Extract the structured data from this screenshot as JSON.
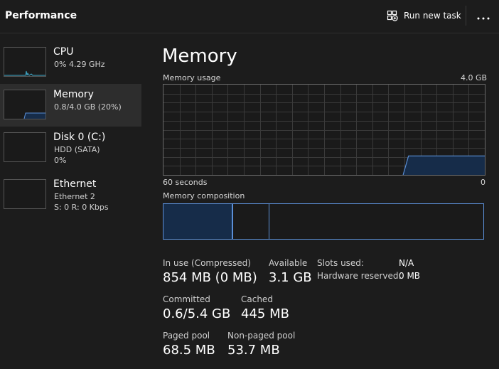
{
  "header": {
    "title": "Performance",
    "run_task_label": "Run new task",
    "more_label": "···"
  },
  "sidebar": {
    "items": [
      {
        "name": "CPU",
        "sub1": "0% 4.29 GHz",
        "sub2": ""
      },
      {
        "name": "Memory",
        "sub1": "0.8/4.0 GB (20%)",
        "sub2": ""
      },
      {
        "name": "Disk 0 (C:)",
        "sub1": "HDD (SATA)",
        "sub2": "0%"
      },
      {
        "name": "Ethernet",
        "sub1": "Ethernet 2",
        "sub2": "S: 0 R: 0 Kbps"
      }
    ],
    "selected_index": 1
  },
  "main": {
    "title": "Memory",
    "usage_label": "Memory usage",
    "usage_max": "4.0 GB",
    "time_span_label": "60 seconds",
    "time_end_label": "0",
    "composition_label": "Memory composition",
    "composition": {
      "in_use_fraction": 0.213,
      "modified_fraction": 0.004,
      "standby_fraction": 0.111
    },
    "usage_history": {
      "samples_fraction": [
        0,
        0,
        0,
        0,
        0,
        0,
        0,
        0,
        0,
        0,
        0,
        0,
        0,
        0,
        0,
        0,
        0,
        0,
        0,
        0,
        0,
        0,
        0,
        0,
        0,
        0,
        0,
        0,
        0,
        0,
        0,
        0,
        0,
        0,
        0,
        0,
        0,
        0,
        0,
        0,
        0,
        0,
        0,
        0,
        0,
        0.21,
        0.21,
        0.21,
        0.21,
        0.21,
        0.21,
        0.21,
        0.21,
        0.21,
        0.21,
        0.21,
        0.21,
        0.21,
        0.21,
        0.21
      ],
      "visible_from_index": 44
    },
    "stats": {
      "in_use": {
        "label": "In use (Compressed)",
        "value": "854 MB (0 MB)"
      },
      "available": {
        "label": "Available",
        "value": "3.1 GB"
      },
      "committed": {
        "label": "Committed",
        "value": "0.6/5.4 GB"
      },
      "cached": {
        "label": "Cached",
        "value": "445 MB"
      },
      "paged_pool": {
        "label": "Paged pool",
        "value": "68.5 MB"
      },
      "non_paged_pool": {
        "label": "Non-paged pool",
        "value": "53.7 MB"
      }
    },
    "details": {
      "slots_used": {
        "label": "Slots used:",
        "value": "N/A"
      },
      "hardware_reserved": {
        "label": "Hardware reserved:",
        "value": "0 MB"
      }
    }
  },
  "colors": {
    "accent": "#5b8fd6",
    "fill": "#162c49",
    "grid": "#3a3a3a"
  }
}
